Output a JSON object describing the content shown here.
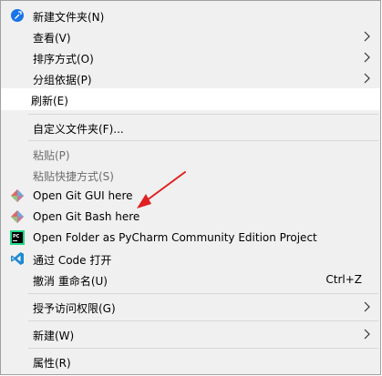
{
  "menu": {
    "items": [
      {
        "label": "新建文件夹(N)",
        "icon": "new-folder-icon"
      },
      {
        "label": "查看(V)",
        "submenu": true
      },
      {
        "label": "排序方式(O)",
        "submenu": true
      },
      {
        "label": "分组依据(P)",
        "submenu": true
      },
      {
        "label": "刷新(E)",
        "highlighted": true
      },
      {
        "label": "自定义文件夹(F)..."
      },
      {
        "label": "粘贴(P)",
        "disabled": true
      },
      {
        "label": "粘贴快捷方式(S)",
        "disabled": true
      },
      {
        "label": "Open Git GUI here",
        "icon": "git-gui-icon"
      },
      {
        "label": "Open Git Bash here",
        "icon": "git-bash-icon"
      },
      {
        "label": "Open Folder as PyCharm Community Edition Project",
        "icon": "pycharm-icon"
      },
      {
        "label": "通过 Code 打开",
        "icon": "vscode-icon"
      },
      {
        "label": "撤消 重命名(U)",
        "shortcut": "Ctrl+Z"
      },
      {
        "label": "授予访问权限(G)",
        "submenu": true
      },
      {
        "label": "新建(W)",
        "submenu": true
      },
      {
        "label": "属性(R)"
      }
    ]
  },
  "annotation": {
    "color": "#e02020"
  }
}
